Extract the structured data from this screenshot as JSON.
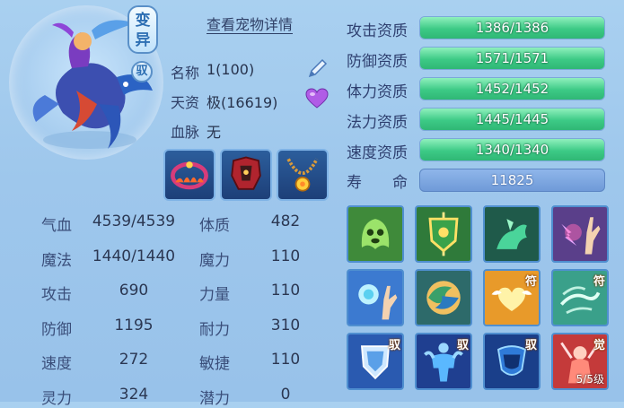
{
  "header": {
    "mutation_badge": "变异",
    "ride_badge": "驭",
    "detail_link": "查看宠物详情"
  },
  "info": {
    "name_label": "名称",
    "name_value": "1(100)",
    "talent_label": "天资",
    "talent_value": "极(16619)",
    "bloodline_label": "血脉",
    "bloodline_value": "无"
  },
  "equipment": [
    {
      "icon": "flame-collar-icon"
    },
    {
      "icon": "armor-icon"
    },
    {
      "icon": "necklace-icon"
    }
  ],
  "stats": [
    {
      "label": "气血",
      "value": "4539/4539",
      "attr_label": "体质",
      "attr_value": "482"
    },
    {
      "label": "魔法",
      "value": "1440/1440",
      "attr_label": "魔力",
      "attr_value": "110"
    },
    {
      "label": "攻击",
      "value": "690",
      "attr_label": "力量",
      "attr_value": "110"
    },
    {
      "label": "防御",
      "value": "1195",
      "attr_label": "耐力",
      "attr_value": "310"
    },
    {
      "label": "速度",
      "value": "272",
      "attr_label": "敏捷",
      "attr_value": "110"
    },
    {
      "label": "灵力",
      "value": "324",
      "attr_label": "潜力",
      "attr_value": "0"
    }
  ],
  "aptitudes": [
    {
      "label": "攻击资质",
      "value": "1386/1386",
      "fill": 1.0
    },
    {
      "label": "防御资质",
      "value": "1571/1571",
      "fill": 1.0
    },
    {
      "label": "体力资质",
      "value": "1452/1452",
      "fill": 1.0
    },
    {
      "label": "法力资质",
      "value": "1445/1445",
      "fill": 1.0
    },
    {
      "label": "速度资质",
      "value": "1340/1340",
      "fill": 1.0
    }
  ],
  "lifespan": {
    "label": "寿　　命",
    "value": "11825"
  },
  "skills": [
    {
      "icon": "ghost-face-icon",
      "tag": "",
      "level": ""
    },
    {
      "icon": "shield-banner-icon",
      "tag": "",
      "level": ""
    },
    {
      "icon": "horse-rider-icon",
      "tag": "",
      "level": ""
    },
    {
      "icon": "palm-lightning-icon",
      "tag": "",
      "level": ""
    },
    {
      "icon": "palm-orb-icon",
      "tag": "",
      "level": ""
    },
    {
      "icon": "swirl-orb-icon",
      "tag": "",
      "level": ""
    },
    {
      "icon": "winged-heart-icon",
      "tag": "符",
      "level": ""
    },
    {
      "icon": "wind-swirl-icon",
      "tag": "符",
      "level": ""
    },
    {
      "icon": "shield-icon",
      "tag": "驭",
      "level": ""
    },
    {
      "icon": "muscle-figure-icon",
      "tag": "驭",
      "level": ""
    },
    {
      "icon": "cup-shield-icon",
      "tag": "驭",
      "level": ""
    },
    {
      "icon": "awakened-warrior-icon",
      "tag": "觉",
      "level": "5/5级"
    }
  ],
  "colors": {
    "bar_fill": "#3dca86",
    "lifespan_bar": "#6f9ad8",
    "panel_bg": "#a9d0f0"
  }
}
